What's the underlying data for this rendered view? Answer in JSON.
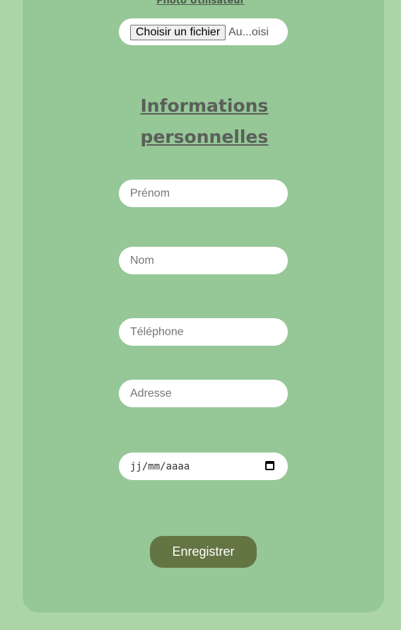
{
  "photo": {
    "label": "Photo Utilisateur",
    "file_button": "Choisir un fichier",
    "file_status": "Au...oisi"
  },
  "section": {
    "title": "Informations personnelles"
  },
  "fields": {
    "firstname_placeholder": "Prénom",
    "lastname_placeholder": "Nom",
    "phone_placeholder": "Téléphone",
    "address_placeholder": "Adresse",
    "date_placeholder": "jj/mm/aaaa"
  },
  "actions": {
    "submit_label": "Enregistrer"
  },
  "colors": {
    "page_bg": "#acd5a7",
    "card_bg": "#96c797",
    "button_bg": "#637542"
  },
  "icons": {
    "date": "calendar-icon"
  }
}
